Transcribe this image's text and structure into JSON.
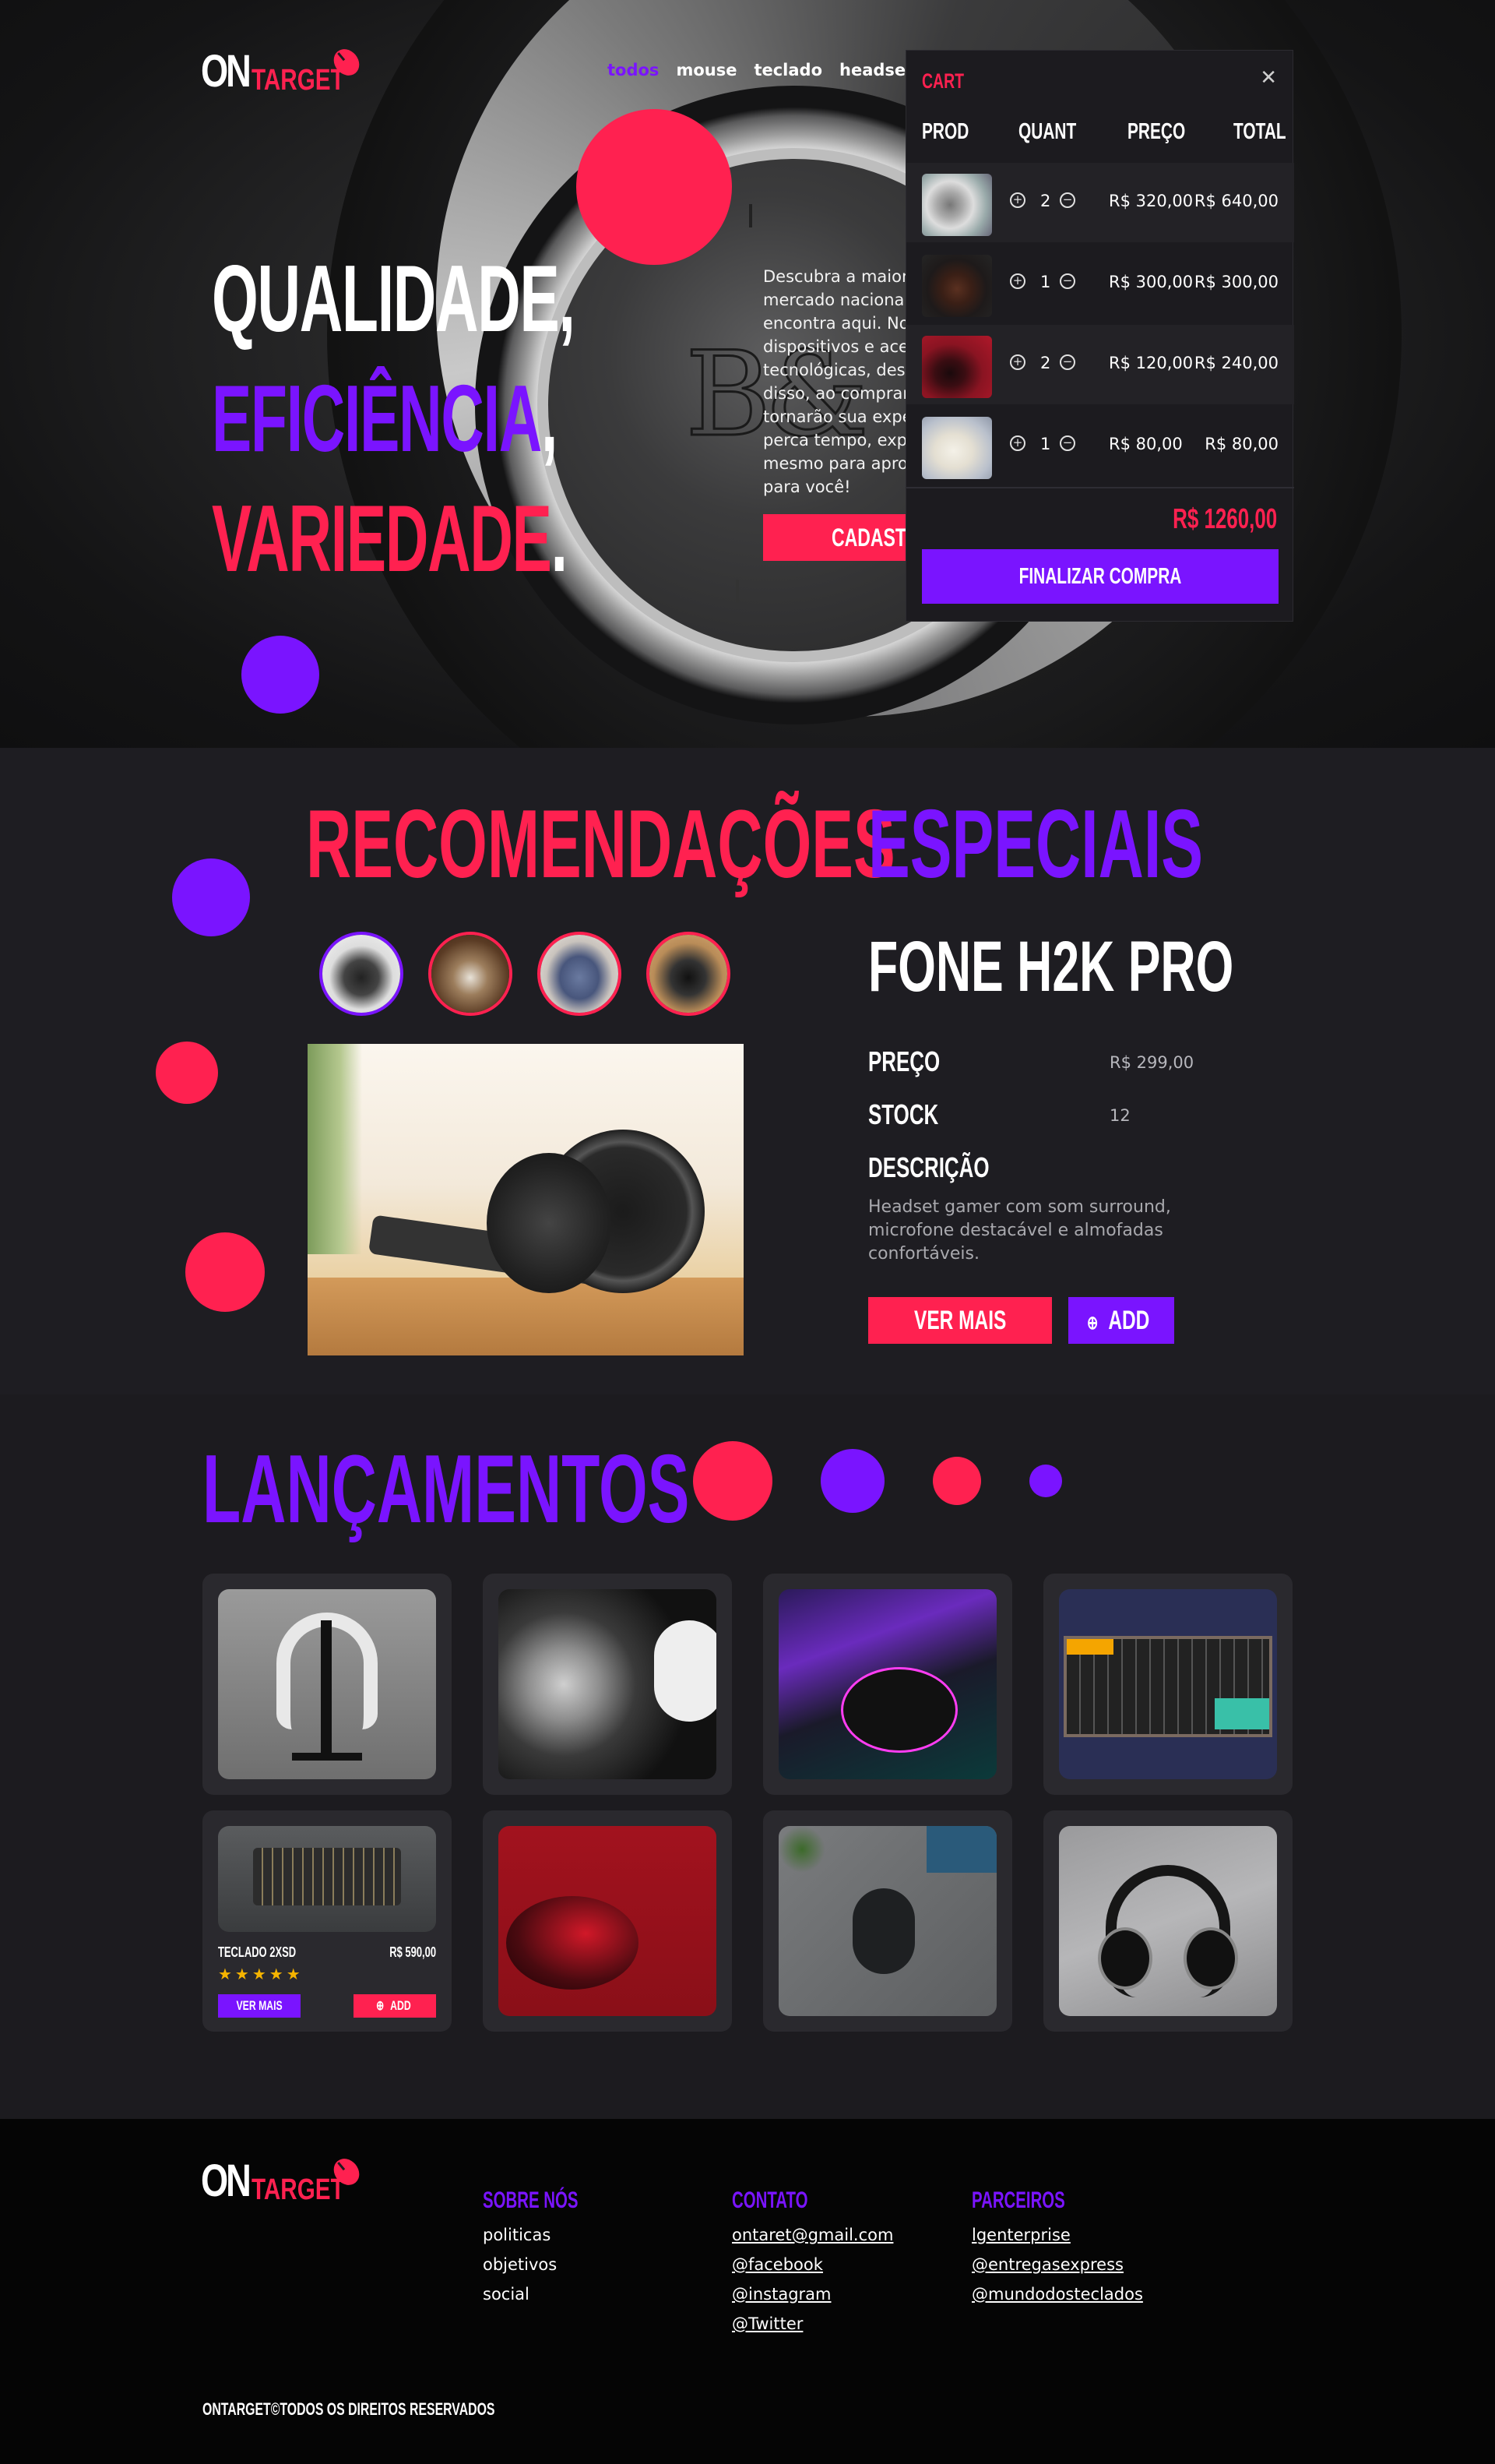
{
  "brand": {
    "on": "ON",
    "target": "TARGET"
  },
  "nav": {
    "items": [
      "todos",
      "mouse",
      "teclado",
      "headset"
    ],
    "active": "todos"
  },
  "hero": {
    "line1": "QUALIDADE,",
    "line2": "EFICIÊNCIA",
    "line2_comma": ",",
    "line3": "VARIEDADE",
    "line3_dot": ".",
    "description": "Descubra a maior v\nmercado nacional\nencontra aqui. Nos\ndispositivos e aces\ntecnológicas, desd\ndisso, ao comprar\ntornarão sua exper\nperca tempo, explo\nmesmo para aprov\npara você!",
    "cta": "CADASTRE"
  },
  "cart": {
    "title": "CART",
    "close_icon": "close-icon",
    "headers": [
      "PROD",
      "QUANT",
      "PREÇO",
      "TOTAL"
    ],
    "items": [
      {
        "qty": "2",
        "price": "R$ 320,00",
        "total": "R$ 640,00"
      },
      {
        "qty": "1",
        "price": "R$ 300,00",
        "total": "R$ 300,00"
      },
      {
        "qty": "2",
        "price": "R$ 120,00",
        "total": "R$ 240,00"
      },
      {
        "qty": "1",
        "price": "R$ 80,00",
        "total": "R$ 80,00"
      }
    ],
    "sum": "R$ 1260,00",
    "checkout": "FINALIZAR COMPRA"
  },
  "recommend": {
    "title_a": "RECOMENDAÇÕES",
    "title_b": "ESPECIAIS",
    "product": {
      "name": "FONE H2K PRO",
      "price_label": "PREÇO",
      "price": "R$ 299,00",
      "stock_label": "STOCK",
      "stock": "12",
      "desc_label": "DESCRIÇÃO",
      "desc": "Headset gamer com som surround, microfone destacável e almofadas confortáveis."
    },
    "more": "VER MAIS",
    "add": "ADD"
  },
  "launches": {
    "title": "LANÇAMENTOS",
    "card": {
      "name": "TECLADO 2XSD",
      "price": "R$ 590,00",
      "stars": "★★★★★",
      "more": "VER MAIS",
      "add": "ADD"
    }
  },
  "footer": {
    "about": {
      "title": "SOBRE NÓS",
      "links": [
        "politicas",
        "objetivos",
        "social"
      ]
    },
    "contact": {
      "title": "CONTATO",
      "links": [
        "ontaret@gmail.com",
        "@facebook",
        "@instagram",
        "@Twitter"
      ]
    },
    "partners": {
      "title": "PARCEIROS",
      "links": [
        "lgenterprise",
        "@entregasexpress",
        "@mundodosteclados"
      ]
    },
    "copyright": "ONTARGET©TODOS OS DIREITOS RESERVADOS"
  },
  "colors": {
    "accent_red": "#ff2150",
    "accent_purple": "#7a14ff",
    "bg": "#1c1b1f"
  }
}
